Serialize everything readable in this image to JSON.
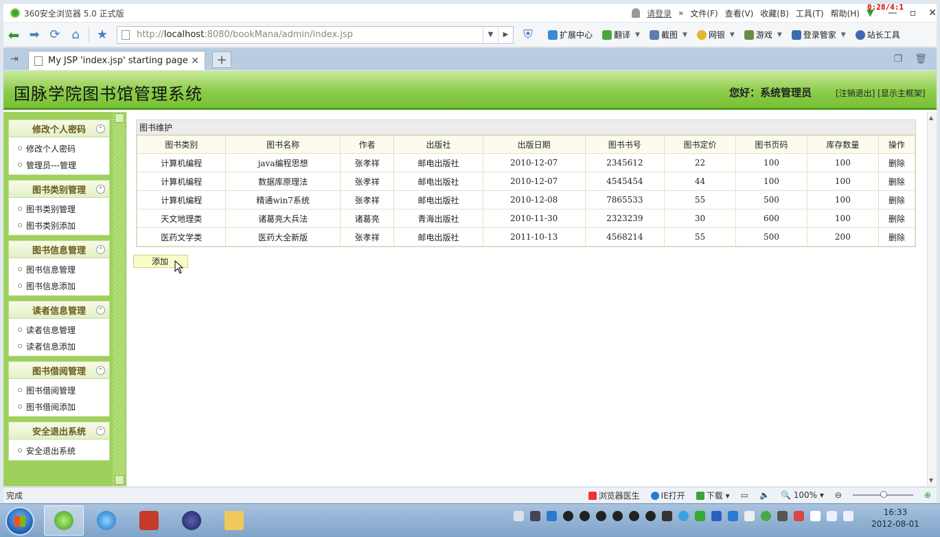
{
  "browser": {
    "title": "360安全浏览器 5.0 正式版",
    "login": "请登录",
    "menus": [
      "文件(F)",
      "查看(V)",
      "收藏(B)",
      "工具(T)",
      "帮助(H)"
    ],
    "timer": "0:28/4:1",
    "url_prefix": "http://",
    "url_host": "localhost",
    "url_path": ":8080/bookMana/admin/index.jsp",
    "tools": [
      "扩展中心",
      "翻译",
      "截图",
      "网银",
      "游戏",
      "登录管家",
      "站长工具"
    ],
    "tab_title": "My JSP 'index.jsp' starting page",
    "status_text": "完成",
    "status_items": [
      "浏览器医生",
      "IE打开",
      "下载"
    ],
    "zoom": "100%"
  },
  "header": {
    "title": "国脉学院图书馆管理系统",
    "greeting": "您好：系统管理员",
    "links": "[注销退出] [显示主框架]"
  },
  "sidebar": [
    {
      "title": "修改个人密码",
      "items": [
        "修改个人密码",
        "管理员---管理"
      ]
    },
    {
      "title": "图书类别管理",
      "items": [
        "图书类别管理",
        "图书类别添加"
      ]
    },
    {
      "title": "图书信息管理",
      "items": [
        "图书信息管理",
        "图书信息添加"
      ]
    },
    {
      "title": "读者信息管理",
      "items": [
        "读者信息管理",
        "读者信息添加"
      ]
    },
    {
      "title": "图书借阅管理",
      "items": [
        "图书借阅管理",
        "图书借阅添加"
      ]
    },
    {
      "title": "安全退出系统",
      "items": [
        "安全退出系统"
      ]
    }
  ],
  "panel": {
    "title": "图书维护",
    "columns": [
      "图书类别",
      "图书名称",
      "作者",
      "出版社",
      "出版日期",
      "图书书号",
      "图书定价",
      "图书页码",
      "库存数量",
      "操作"
    ],
    "rows": [
      [
        "计算机编程",
        "java编程思想",
        "张孝祥",
        "邮电出版社",
        "2010-12-07",
        "2345612",
        "22",
        "100",
        "100",
        "删除"
      ],
      [
        "计算机编程",
        "数据库原理法",
        "张孝祥",
        "邮电出版社",
        "2010-12-07",
        "4545454",
        "44",
        "100",
        "100",
        "删除"
      ],
      [
        "计算机编程",
        "精通win7系统",
        "张孝祥",
        "邮电出版社",
        "2010-12-08",
        "7865533",
        "55",
        "500",
        "100",
        "删除"
      ],
      [
        "天文地理类",
        "诸葛亮大兵法",
        "诸葛亮",
        "青海出版社",
        "2010-11-30",
        "2323239",
        "30",
        "600",
        "100",
        "删除"
      ],
      [
        "医药文学类",
        "医药大全新版",
        "张孝祥",
        "邮电出版社",
        "2011-10-13",
        "4568214",
        "55",
        "500",
        "200",
        "删除"
      ]
    ],
    "add_label": "添加"
  },
  "taskbar": {
    "time": "16:33",
    "date": "2012-08-01"
  },
  "colors": {
    "banner": "#8ccc4a",
    "sidebar": "#9ed15b",
    "accent_text": "#6b5a1e"
  }
}
